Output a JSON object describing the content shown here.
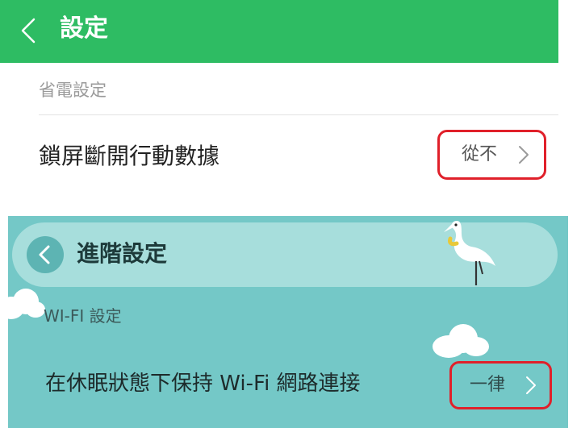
{
  "top": {
    "title": "設定",
    "section": "省電設定",
    "row": {
      "label": "鎖屏斷開行動數據",
      "value": "從不"
    },
    "colors": {
      "appbar": "#2ebc63",
      "highlight": "#e0202a"
    }
  },
  "bottom": {
    "title": "進階設定",
    "section": "WI-FI 設定",
    "row": {
      "label": "在休眠狀態下保持 Wi-Fi 網路連接",
      "value": "一律"
    },
    "colors": {
      "background": "#74c8c7",
      "pill": "#a7dedc",
      "highlight": "#e0202a"
    },
    "decorations": [
      "crane-illustration",
      "cloud-illustration"
    ]
  }
}
